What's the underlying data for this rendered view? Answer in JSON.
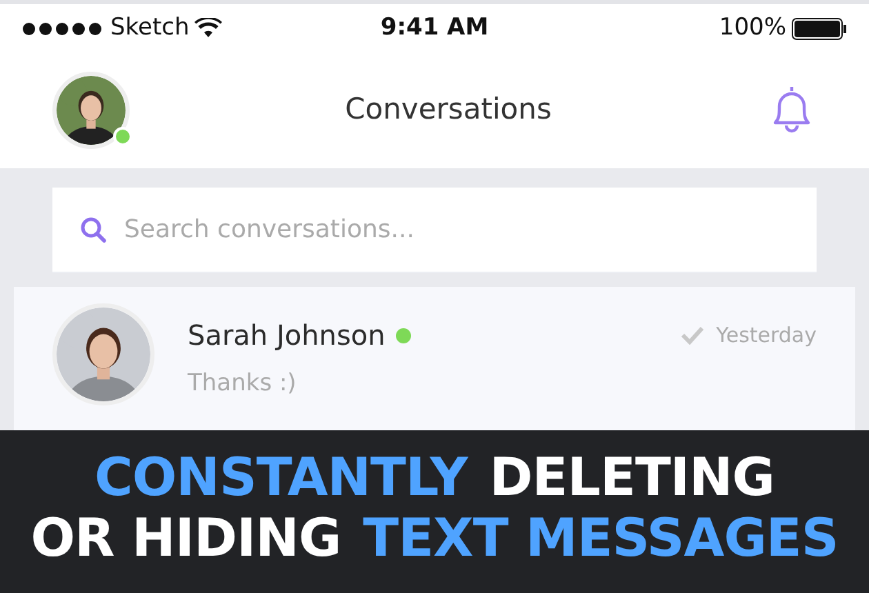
{
  "status_bar": {
    "carrier": "Sketch",
    "time": "9:41 AM",
    "battery": "100%"
  },
  "header": {
    "title": "Conversations",
    "user_online": true
  },
  "search": {
    "placeholder": "Search conversations..."
  },
  "conversations": [
    {
      "name": "Sarah Johnson",
      "online": true,
      "read": true,
      "time": "Yesterday",
      "message": "Thanks :)"
    }
  ],
  "banner": {
    "lines": [
      [
        {
          "text": "CONSTANTLY",
          "highlight": true
        },
        {
          "text": "DELETING",
          "highlight": false
        }
      ],
      [
        {
          "text": "OR HIDING",
          "highlight": false
        },
        {
          "text": "TEXT MESSAGES",
          "highlight": true
        }
      ]
    ]
  }
}
